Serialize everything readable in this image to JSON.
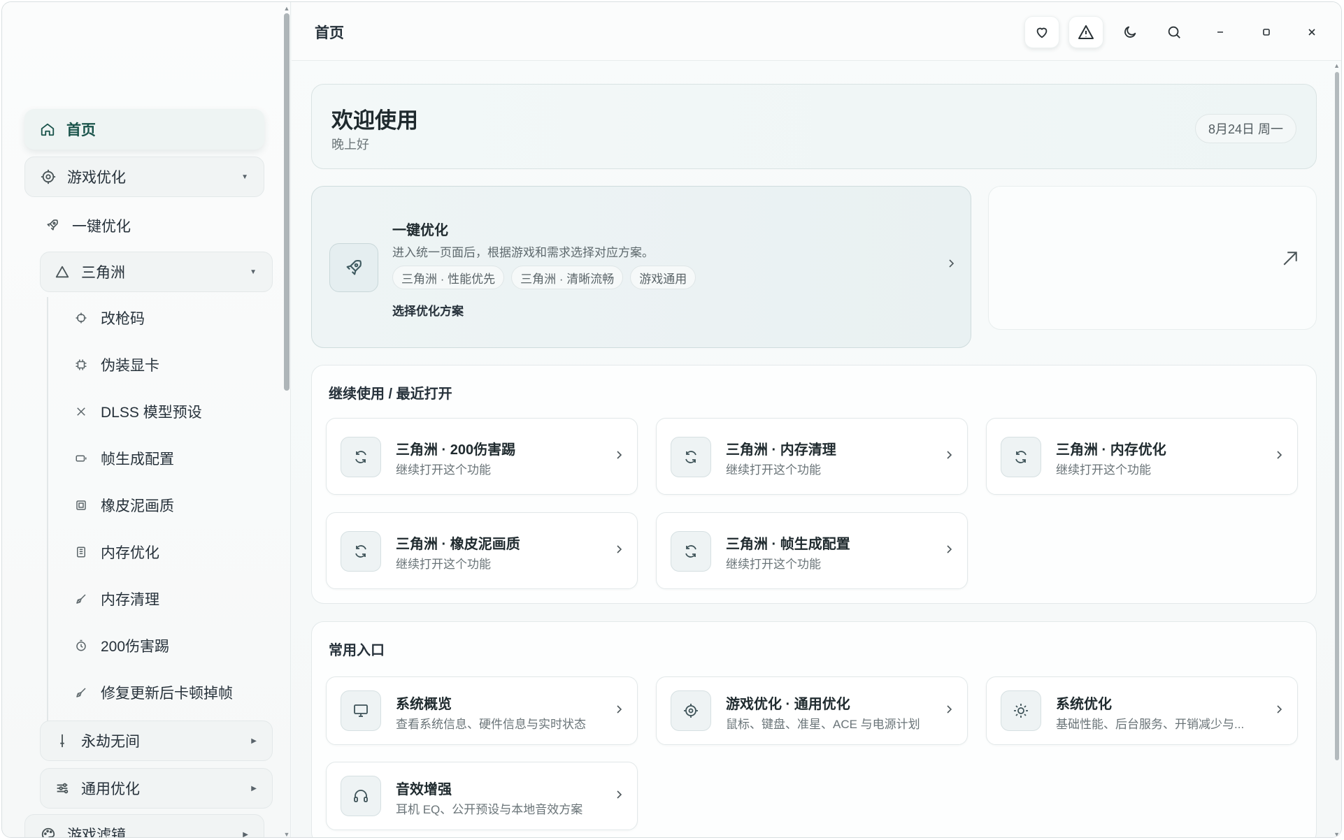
{
  "sidebar": {
    "home": "首页",
    "game_opt": "游戏优化",
    "one_click": "一键优化",
    "delta": "三角洲",
    "sub_items": [
      "改枪码",
      "伪装显卡",
      "DLSS 模型预设",
      "帧生成配置",
      "橡皮泥画质",
      "内存优化",
      "内存清理",
      "200伤害踢",
      "修复更新后卡顿掉帧"
    ],
    "naraka": "永劫无间",
    "general_opt": "通用优化",
    "game_filter": "游戏滤镜"
  },
  "titlebar": {
    "page_title": "首页",
    "icons": [
      "heart-icon",
      "warning-icon",
      "moon-icon",
      "search-icon",
      "minimize-icon",
      "maximize-icon",
      "close-icon"
    ]
  },
  "welcome": {
    "title": "欢迎使用",
    "greeting": "晚上好",
    "date": "8月24日 周一"
  },
  "one_click": {
    "title": "一键优化",
    "description": "进入统一页面后，根据游戏和需求选择对应方案。",
    "tags": [
      "三角洲 · 性能优先",
      "三角洲 · 清晰流畅",
      "游戏通用"
    ],
    "action": "选择优化方案"
  },
  "recent": {
    "title": "继续使用 / 最近打开",
    "items": [
      {
        "title": "三角洲 · 200伤害踢",
        "subtitle": "继续打开这个功能"
      },
      {
        "title": "三角洲 · 内存清理",
        "subtitle": "继续打开这个功能"
      },
      {
        "title": "三角洲 · 内存优化",
        "subtitle": "继续打开这个功能"
      },
      {
        "title": "三角洲 · 橡皮泥画质",
        "subtitle": "继续打开这个功能"
      },
      {
        "title": "三角洲 · 帧生成配置",
        "subtitle": "继续打开这个功能"
      }
    ]
  },
  "common": {
    "title": "常用入口",
    "items": [
      {
        "title": "系统概览",
        "subtitle": "查看系统信息、硬件信息与实时状态",
        "icon": "monitor-icon"
      },
      {
        "title": "游戏优化 · 通用优化",
        "subtitle": "鼠标、键盘、准星、ACE 与电源计划",
        "icon": "target-icon"
      },
      {
        "title": "系统优化",
        "subtitle": "基础性能、后台服务、开销减少与...",
        "icon": "sun-icon"
      },
      {
        "title": "音效增强",
        "subtitle": "耳机 EQ、公开预设与本地音效方案",
        "icon": "headphones-icon"
      }
    ]
  },
  "colors": {
    "accent": "#19534a",
    "background": "#f7fafa",
    "card": "#ffffff"
  }
}
